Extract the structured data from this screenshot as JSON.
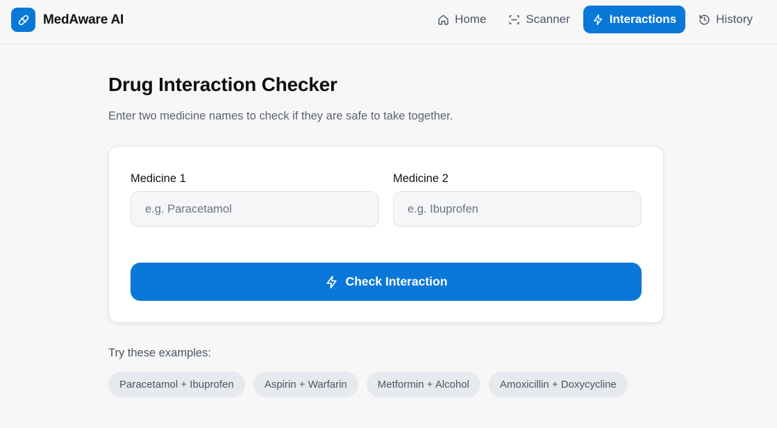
{
  "app": {
    "name": "MedAware AI",
    "logo_icon": "pill-icon",
    "accent": "#0a78d8"
  },
  "nav": {
    "items": [
      {
        "label": "Home",
        "icon": "home-icon",
        "active": false
      },
      {
        "label": "Scanner",
        "icon": "scan-icon",
        "active": false
      },
      {
        "label": "Interactions",
        "icon": "lightning-icon",
        "active": true
      },
      {
        "label": "History",
        "icon": "history-icon",
        "active": false
      }
    ]
  },
  "page": {
    "title": "Drug Interaction Checker",
    "subtitle": "Enter two medicine names to check if they are safe to take together."
  },
  "form": {
    "medicine1": {
      "label": "Medicine 1",
      "placeholder": "e.g. Paracetamol",
      "value": ""
    },
    "medicine2": {
      "label": "Medicine 2",
      "placeholder": "e.g. Ibuprofen",
      "value": ""
    },
    "submit_label": "Check Interaction",
    "submit_icon": "lightning-icon"
  },
  "examples": {
    "label": "Try these examples:",
    "items": [
      "Paracetamol + Ibuprofen",
      "Aspirin + Warfarin",
      "Metformin + Alcohol",
      "Amoxicillin + Doxycycline"
    ]
  }
}
